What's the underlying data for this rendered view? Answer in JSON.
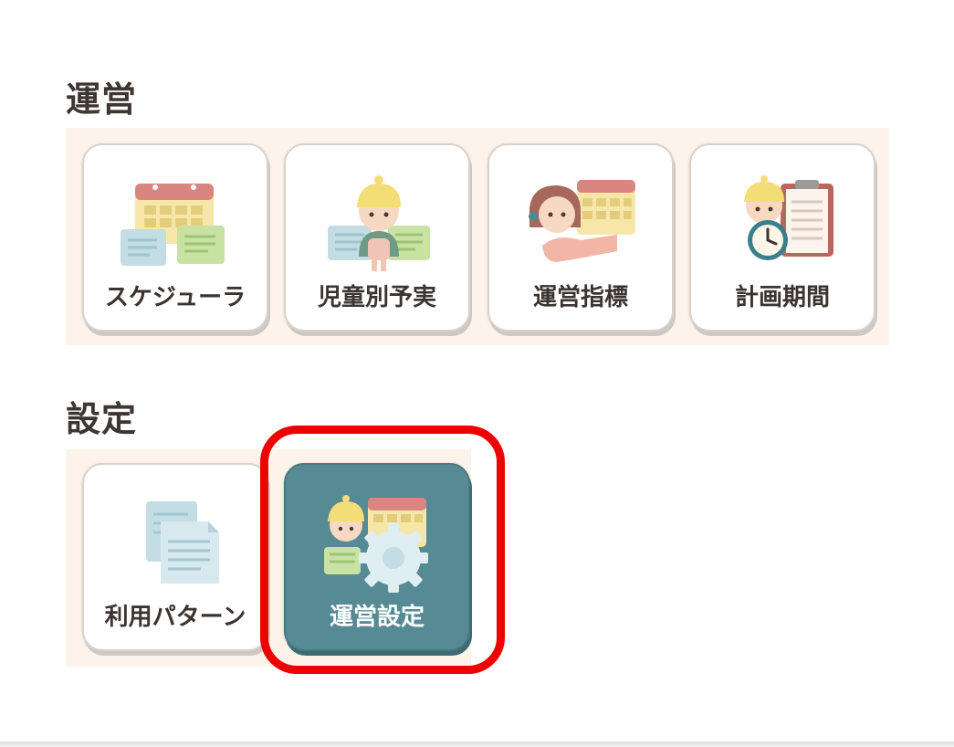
{
  "sections": {
    "operations": {
      "title": "運営",
      "tiles": [
        {
          "label": "スケジューラ",
          "icon": "scheduler-calendar-icon"
        },
        {
          "label": "児童別予実",
          "icon": "child-plan-actual-icon"
        },
        {
          "label": "運営指標",
          "icon": "operation-metrics-icon"
        },
        {
          "label": "計画期間",
          "icon": "plan-period-clipboard-icon"
        }
      ]
    },
    "settings": {
      "title": "設定",
      "tiles": [
        {
          "label": "利用パターン",
          "icon": "usage-pattern-documents-icon"
        },
        {
          "label": "運営設定",
          "icon": "operation-settings-gear-icon",
          "selected": true
        }
      ]
    }
  },
  "colors": {
    "band_background": "#fdf3ea",
    "active_tile": "#568a94",
    "highlight": "#ee0000"
  }
}
